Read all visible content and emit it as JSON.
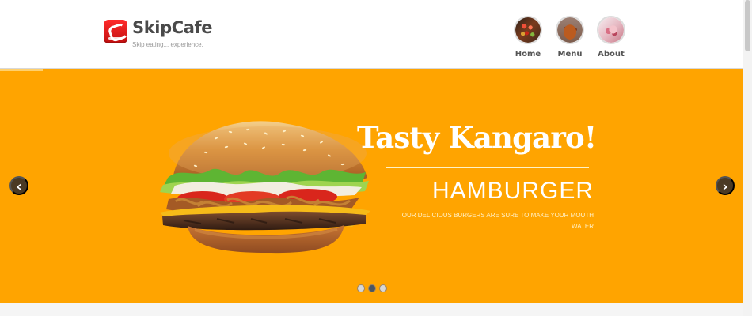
{
  "header": {
    "brand": "SkipCafe",
    "tagline": "Skip eating... experience.",
    "nav": [
      {
        "label": "Home",
        "icon": "home-food-thumbnail-icon"
      },
      {
        "label": "Menu",
        "icon": "menu-food-thumbnail-icon"
      },
      {
        "label": "About",
        "icon": "about-food-thumbnail-icon"
      }
    ]
  },
  "hero": {
    "title": "Tasty Kangaro!",
    "subtitle": "HAMBURGER",
    "description": "OUR DELICIOUS BURGERS ARE SURE TO MAKE YOUR MOUTH WATER",
    "left_arrow": "‹",
    "right_arrow": "›",
    "active_slide": 2,
    "total_slides": 3,
    "background": "#ffa400"
  },
  "colors": {
    "brand_red": "#d91818",
    "text_dark": "#4a4a4a",
    "hero_orange": "#ffa400",
    "arrow_dark": "#4b3a24"
  }
}
